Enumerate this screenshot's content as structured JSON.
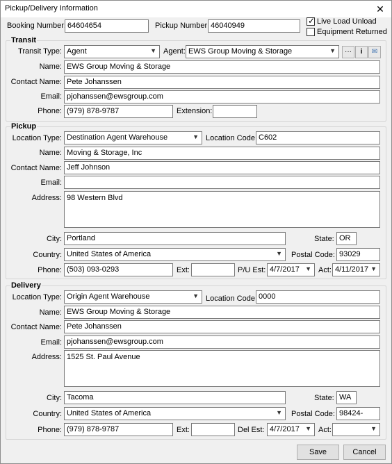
{
  "window": {
    "title": "Pickup/Delivery Information",
    "close_glyph": "✕"
  },
  "header": {
    "booking_label": "Booking Number:",
    "booking_value": "64604654",
    "pickup_label": "Pickup Number:",
    "pickup_value": "46040949",
    "live_load_label": "Live Load Unload",
    "live_load_checked": true,
    "equipment_label": "Equipment Returned",
    "equipment_checked": false
  },
  "transit": {
    "group_title": "Transit",
    "type_label": "Transit Type:",
    "type_value": "Agent",
    "agent_label": "Agent:",
    "agent_value": "EWS Group Moving & Storage",
    "name_label": "Name:",
    "name_value": "EWS Group Moving & Storage",
    "contact_label": "Contact Name:",
    "contact_value": "Pete Johanssen",
    "email_label": "Email:",
    "email_value": "pjohanssen@ewsgroup.com",
    "phone_label": "Phone:",
    "phone_value": "(979) 878-9787",
    "ext_label": "Extension:",
    "ext_value": ""
  },
  "pickup": {
    "group_title": "Pickup",
    "loctype_label": "Location Type:",
    "loctype_value": "Destination Agent Warehouse",
    "loccode_label": "Location Code:",
    "loccode_value": "C602",
    "name_label": "Name:",
    "name_value": "Moving & Storage, Inc",
    "contact_label": "Contact Name:",
    "contact_value": "Jeff Johnson",
    "email_label": "Email:",
    "email_value": "",
    "address_label": "Address:",
    "address_value": "98 Western Blvd",
    "city_label": "City:",
    "city_value": "Portland",
    "state_label": "State:",
    "state_value": "OR",
    "country_label": "Country:",
    "country_value": "United States of America",
    "postal_label": "Postal Code:",
    "postal_value": "93029",
    "phone_label": "Phone:",
    "phone_value": "(503) 093-0293",
    "ext_label": "Ext:",
    "ext_value": "",
    "est_label": "P/U Est:",
    "est_value": "4/7/2017",
    "act_label": "Act:",
    "act_value": "4/11/2017"
  },
  "delivery": {
    "group_title": "Delivery",
    "loctype_label": "Location Type:",
    "loctype_value": "Origin Agent Warehouse",
    "loccode_label": "Location Code:",
    "loccode_value": "0000",
    "name_label": "Name:",
    "name_value": "EWS Group Moving & Storage",
    "contact_label": "Contact Name:",
    "contact_value": "Pete Johanssen",
    "email_label": "Email:",
    "email_value": "pjohanssen@ewsgroup.com",
    "address_label": "Address:",
    "address_value": "1525 St. Paul Avenue",
    "city_label": "City:",
    "city_value": "Tacoma",
    "state_label": "State:",
    "state_value": "WA",
    "country_label": "Country:",
    "country_value": "United States of America",
    "postal_label": "Postal Code:",
    "postal_value": "98424-",
    "phone_label": "Phone:",
    "phone_value": "(979) 878-9787",
    "ext_label": "Ext:",
    "ext_value": "",
    "est_label": "Del Est:",
    "est_value": "4/7/2017",
    "act_label": "Act:",
    "act_value": ""
  },
  "footer": {
    "save_label": "Save",
    "cancel_label": "Cancel"
  },
  "toolbar": {
    "more_glyph": "···",
    "info_glyph": "i",
    "mail_glyph": "✉"
  },
  "icons": {
    "dropdown": "chevron-down-icon",
    "more": "ellipsis-icon",
    "info": "info-icon",
    "email": "envelope-icon"
  }
}
